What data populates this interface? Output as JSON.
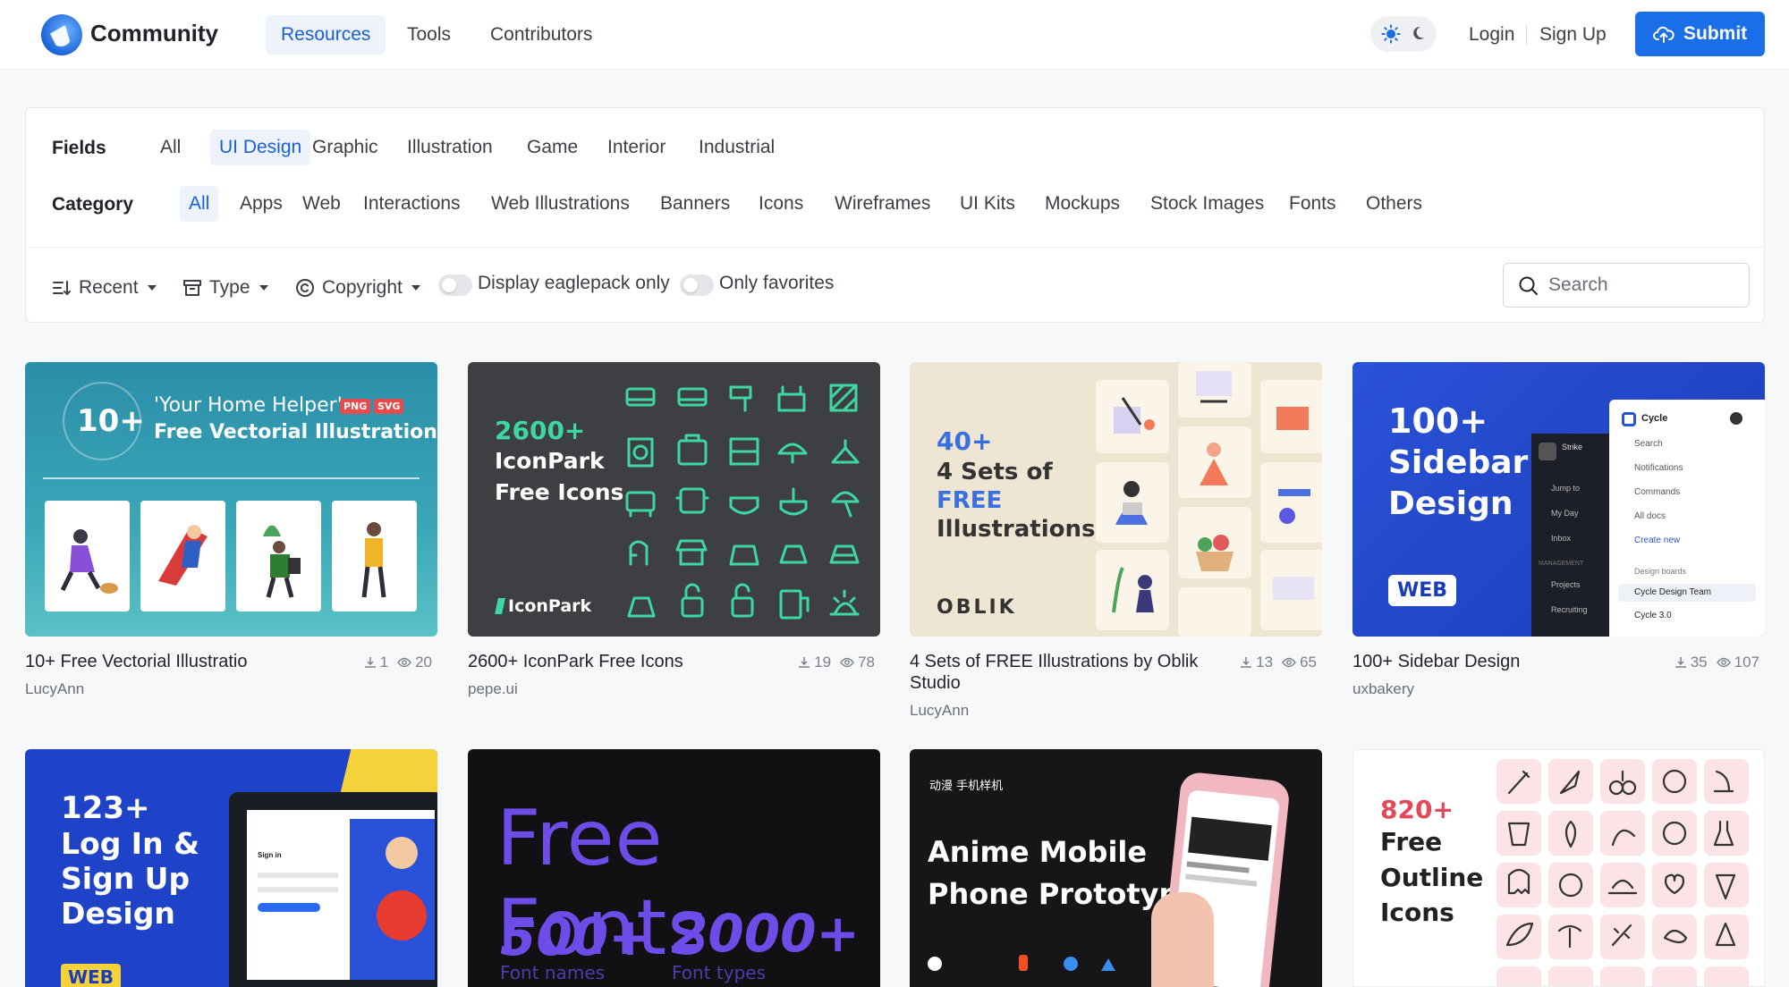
{
  "header": {
    "brand": "Community",
    "nav": [
      "Resources",
      "Tools",
      "Contributors"
    ],
    "login": "Login",
    "signup": "Sign Up",
    "submit": "Submit",
    "accent_color": "#1a6ee8"
  },
  "filters": {
    "fields_label": "Fields",
    "fields": [
      "All",
      "UI Design",
      "Graphic",
      "Illustration",
      "Game",
      "Interior",
      "Industrial"
    ],
    "fields_selected": "UI Design",
    "category_label": "Category",
    "categories": [
      "All",
      "Apps",
      "Web",
      "Interactions",
      "Web Illustrations",
      "Banners",
      "Icons",
      "Wireframes",
      "UI Kits",
      "Mockups",
      "Stock Images",
      "Fonts",
      "Others"
    ],
    "category_selected": "All",
    "sort": "Recent",
    "type": "Type",
    "copyright": "Copyright",
    "toggle_eaglepack": "Display eaglepack only",
    "toggle_favorites": "Only favorites",
    "search_placeholder": "Search"
  },
  "cards": [
    {
      "title": "10+ Free Vectorial Illustratio",
      "author": "LucyAnn",
      "downloads": "1",
      "views": "20",
      "thumb": {
        "big": "10+",
        "headline": "'Your Home Helper'",
        "sub": "Free Vectorial Illustration",
        "badge1": "PNG",
        "badge2": "SVG"
      }
    },
    {
      "title": "2600+ IconPark Free Icons",
      "author": "pepe.ui",
      "downloads": "19",
      "views": "78",
      "thumb": {
        "count": "2600+",
        "line1": "IconPark",
        "line2": "Free Icons",
        "brand": "IconPark"
      }
    },
    {
      "title": "4 Sets of FREE Illustrations by Oblik Studio",
      "author": "LucyAnn",
      "downloads": "13",
      "views": "65",
      "thumb": {
        "count": "40+",
        "line1": "4 Sets of",
        "line2": "FREE",
        "line3": "Illustrations",
        "brand": "OBLIK"
      }
    },
    {
      "title": "100+ Sidebar Design",
      "author": "uxbakery",
      "downloads": "35",
      "views": "107",
      "thumb": {
        "count": "100+",
        "line1": "Sidebar",
        "line2": "Design",
        "tag": "WEB",
        "menu": [
          "Cycle",
          "Search",
          "Notifications",
          "Commands",
          "All docs",
          "Create new",
          "Design boards",
          "Cycle Design Team",
          "Cycle 3.0"
        ],
        "side": [
          "Strike",
          "Jump to",
          "My Day",
          "Inbox",
          "MANAGEMENT",
          "Projects",
          "Recruiting"
        ]
      }
    },
    {
      "title": "",
      "author": "",
      "thumb": {
        "count": "123+",
        "line1": "Log In &",
        "line2": "Sign Up",
        "line3": "Design",
        "tag": "WEB",
        "mini_title": "Sign in"
      }
    },
    {
      "title": "",
      "author": "",
      "thumb": {
        "headline": "Free Fonts",
        "num1": "500+",
        "cap1": "Font names",
        "num2": "2000+",
        "cap2": "Font types"
      }
    },
    {
      "title": "",
      "author": "",
      "thumb": {
        "tagline": "动漫 手机样机",
        "line1": "Anime Mobile",
        "line2": "Phone Prototype"
      }
    },
    {
      "title": "",
      "author": "",
      "thumb": {
        "count": "820+",
        "line1": "Free",
        "line2": "Outline",
        "line3": "Icons"
      }
    }
  ]
}
